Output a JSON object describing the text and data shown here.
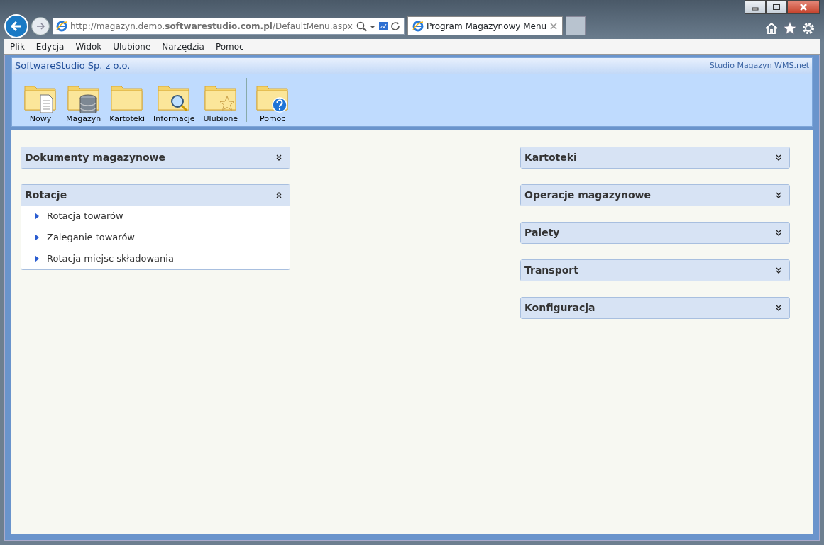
{
  "browser": {
    "address": "http://magazyn.demo.**softwarestudio.com.pl**/DefaultMenu.aspx",
    "tabs": [
      {
        "label": "Program Magazynowy Menu",
        "selected": true
      }
    ],
    "menu": [
      "Plik",
      "Edycja",
      "Widok",
      "Ulubione",
      "Narzędzia",
      "Pomoc"
    ]
  },
  "header": {
    "company": "SoftwareStudio Sp. z o.o.",
    "product": "Studio Magazyn WMS.net"
  },
  "toolbar": [
    {
      "label": "Nowy",
      "kind": "document"
    },
    {
      "label": "Magazyn",
      "kind": "database"
    },
    {
      "label": "Kartoteki",
      "kind": "folder"
    },
    {
      "label": "Informacje",
      "kind": "search"
    },
    {
      "label": "Ulubione",
      "kind": "star"
    },
    {
      "label": "Pomoc",
      "kind": "help",
      "separator_before": true
    }
  ],
  "columns": [
    [
      {
        "title": "Dokumenty magazynowe",
        "expanded": false
      },
      {
        "title": "Rotacje",
        "expanded": true,
        "items": [
          "Rotacja towarów",
          "Zaleganie towarów",
          "Rotacja miejsc składowania"
        ]
      }
    ],
    [
      {
        "title": "Kartoteki",
        "expanded": false
      },
      {
        "title": "Operacje magazynowe",
        "expanded": false
      },
      {
        "title": "Palety",
        "expanded": false
      },
      {
        "title": "Transport",
        "expanded": false
      },
      {
        "title": "Konfiguracja",
        "expanded": false
      }
    ]
  ]
}
